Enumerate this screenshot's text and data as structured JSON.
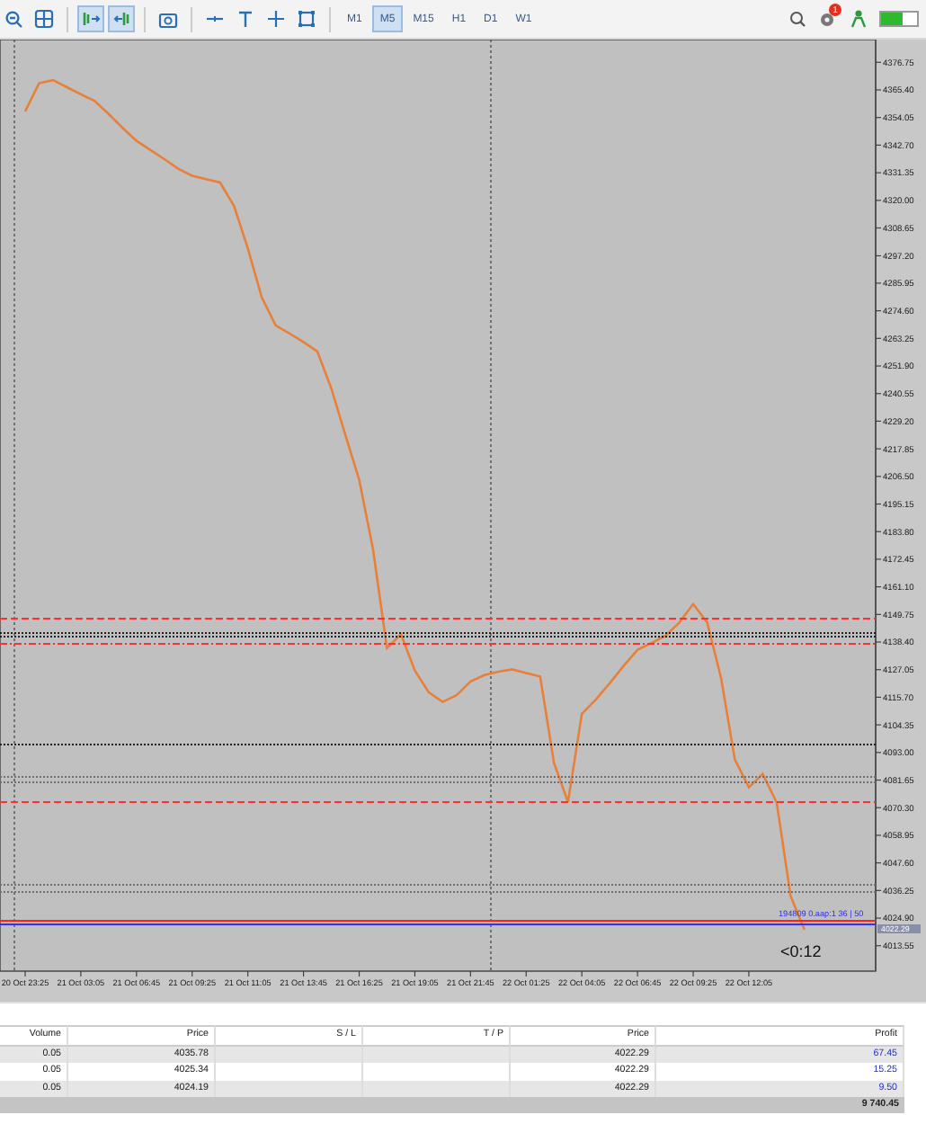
{
  "toolbar": {
    "buttons": [
      {
        "pressed": false
      },
      {
        "pressed": false
      },
      {
        "pressed": true
      },
      {
        "pressed": true
      },
      {
        "pressed": false
      },
      {
        "pressed": false
      },
      {
        "pressed": false
      },
      {
        "pressed": false
      },
      {
        "pressed": false
      }
    ],
    "timeframes": [
      {
        "label": "M1",
        "selected": false
      },
      {
        "label": "M5",
        "selected": true
      },
      {
        "label": "M15",
        "selected": false
      },
      {
        "label": "H1",
        "selected": false
      },
      {
        "label": "D1",
        "selected": false
      },
      {
        "label": "W1",
        "selected": false
      }
    ],
    "notification_badge": "1"
  },
  "chart": {
    "chart_data": {
      "type": "line",
      "categories": [
        "20 Oct 23:25",
        null,
        null,
        null,
        "21 Oct 03:05",
        null,
        null,
        null,
        "21 Oct 06:45",
        null,
        null,
        null,
        "21 Oct 09:25",
        null,
        null,
        null,
        "21 Oct 11:05",
        null,
        null,
        null,
        "21 Oct 13:45",
        null,
        null,
        null,
        "21 Oct 16:25",
        null,
        null,
        null,
        "21 Oct 19:05",
        null,
        null,
        null,
        "21 Oct 21:45",
        null,
        null,
        null,
        "22 Oct 01:25",
        null,
        null,
        null,
        "22 Oct 04:05",
        null,
        null,
        null,
        "22 Oct 06:45",
        null,
        null,
        null,
        "22 Oct 09:25",
        null,
        null,
        null,
        "22 Oct 12:05",
        null,
        null,
        null,
        null,
        null,
        null,
        null,
        null
      ],
      "series": [
        {
          "color": "#e8803a",
          "values": [
            4356.6,
            4368.1,
            4369.4,
            4366.5,
            4363.6,
            4360.8,
            4355.5,
            4349.8,
            4344.5,
            4340.7,
            4336.9,
            4333.0,
            4330.1,
            4328.7,
            4327.3,
            4317.8,
            4300.4,
            4280.1,
            4268.6,
            4265.2,
            4261.7,
            4257.9,
            4242.6,
            4223.7,
            4205.0,
            4176.4,
            4135.9,
            4141.6,
            4126.7,
            4117.7,
            4113.8,
            4116.5,
            4122.2,
            4124.8,
            4126.2,
            4127.2,
            4125.6,
            4124.3,
            4088.7,
            4072.6,
            4108.9,
            4114.7,
            4121.5,
            4128.6,
            4135.2,
            4138.0,
            4140.9,
            4146.4,
            4154.0,
            4146.5,
            4123.7,
            4090.1,
            4078.7,
            4084.2,
            4072.3,
            4034.0,
            4020.1,
            null,
            null,
            null,
            null
          ]
        }
      ],
      "ylim": [
        4003.1,
        4386.1
      ],
      "yticks": [
        {
          "value": 4376.75,
          "label": "4376.75"
        },
        {
          "value": 4365.4,
          "label": "4365.40"
        },
        {
          "value": 4354.05,
          "label": "4354.05"
        },
        {
          "value": 4342.7,
          "label": "4342.70"
        },
        {
          "value": 4331.35,
          "label": "4331.35"
        },
        {
          "value": 4320.0,
          "label": "4320.00"
        },
        {
          "value": 4308.65,
          "label": "4308.65"
        },
        {
          "value": 4297.2,
          "label": "4297.20"
        },
        {
          "value": 4285.95,
          "label": "4285.95"
        },
        {
          "value": 4274.6,
          "label": "4274.60"
        },
        {
          "value": 4263.25,
          "label": "4263.25"
        },
        {
          "value": 4251.9,
          "label": "4251.90"
        },
        {
          "value": 4240.55,
          "label": "4240.55"
        },
        {
          "value": 4229.2,
          "label": "4229.20"
        },
        {
          "value": 4217.85,
          "label": "4217.85"
        },
        {
          "value": 4206.5,
          "label": "4206.50"
        },
        {
          "value": 4195.15,
          "label": "4195.15"
        },
        {
          "value": 4183.8,
          "label": "4183.80"
        },
        {
          "value": 4172.45,
          "label": "4172.45"
        },
        {
          "value": 4161.1,
          "label": "4161.10"
        },
        {
          "value": 4149.75,
          "label": "4149.75"
        },
        {
          "value": 4138.4,
          "label": "4138.40"
        },
        {
          "value": 4127.05,
          "label": "4127.05"
        },
        {
          "value": 4115.7,
          "label": "4115.70"
        },
        {
          "value": 4104.35,
          "label": "4104.35"
        },
        {
          "value": 4093.0,
          "label": "4093.00"
        },
        {
          "value": 4081.65,
          "label": "4081.65"
        },
        {
          "value": 4070.3,
          "label": "4070.30"
        },
        {
          "value": 4058.95,
          "label": "4058.95"
        },
        {
          "value": 4047.6,
          "label": "4047.60"
        },
        {
          "value": 4036.25,
          "label": "4036.25"
        },
        {
          "value": 4024.9,
          "label": "4024.90"
        },
        {
          "value": 4013.55,
          "label": "4013.55"
        }
      ]
    },
    "current_price": "4022.29",
    "trade_label": "194809 0.aap:1 36 | 50",
    "countdown": "<0:12"
  },
  "table": {
    "columns": [
      "Volume",
      "Price",
      "S / L",
      "T / P",
      "Price",
      "Profit"
    ],
    "rows": [
      [
        "0.05",
        "4035.78",
        "",
        "",
        "4022.29",
        "67.45"
      ],
      [
        "0.05",
        "4025.34",
        "",
        "",
        "4022.29",
        "15.25"
      ],
      [
        "0.05",
        "4024.19",
        "",
        "",
        "4022.29",
        "9.50"
      ]
    ],
    "total": "9 740.45"
  }
}
